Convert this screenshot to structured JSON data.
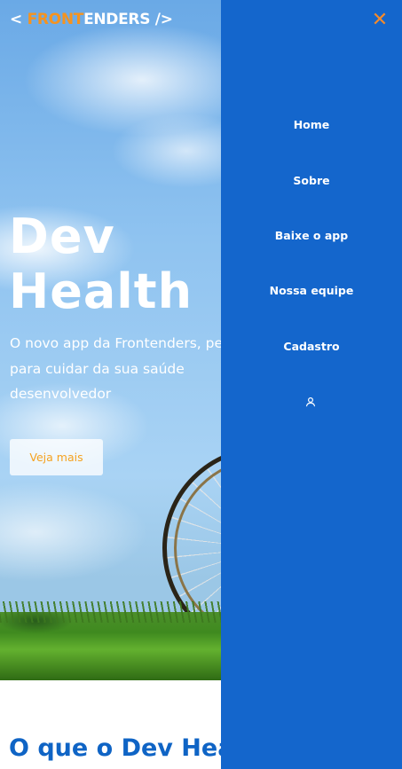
{
  "logo": {
    "open": "<",
    "front": "FRONT",
    "enders": "ENDERS",
    "close": "/>"
  },
  "hero": {
    "title_line1": "Dev",
    "title_line2": "Health",
    "subtitle": "O novo app da Frontenders, pensado para cuidar da sua saúde desenvolvedor",
    "cta_label": "Veja mais"
  },
  "section": {
    "title": "O que o Dev Health"
  },
  "drawer": {
    "close_symbol": "✕",
    "items": [
      {
        "label": "Home"
      },
      {
        "label": "Sobre"
      },
      {
        "label": "Baixe o app"
      },
      {
        "label": "Nossa equipe"
      },
      {
        "label": "Cadastro"
      }
    ],
    "account_icon": "user-icon"
  },
  "colors": {
    "brand_blue": "#1466cc",
    "brand_orange": "#f5931f",
    "heading_blue": "#0f64c5"
  }
}
